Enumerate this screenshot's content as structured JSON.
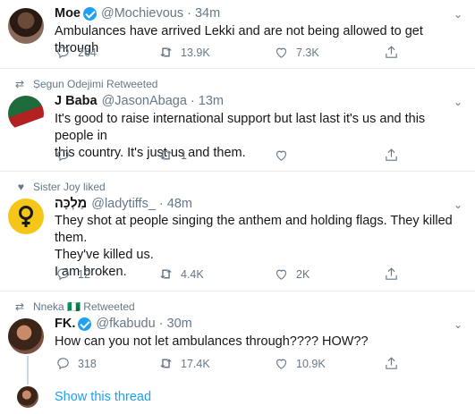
{
  "tweets": [
    {
      "name": "Moe",
      "verified": true,
      "handle": "@Mochievous",
      "time": "34m",
      "text": [
        "Ambulances have arrived Lekki and are not being allowed to get through"
      ],
      "replies": "264",
      "retweets": "13.9K",
      "likes": "7.3K"
    },
    {
      "context": "Ṣegun Odejimi Retweeted",
      "name": "J Baba",
      "handle": "@JasonAbaga",
      "time": "13m",
      "text": [
        "It's good to raise international support but last last it's us and this people in",
        "this country. It's just us and them."
      ],
      "replies": "",
      "retweets": "1",
      "likes": ""
    },
    {
      "context": "Sister Joy liked",
      "name": "מַלְכָּה",
      "handle": "@ladytiffs_",
      "time": "48m",
      "text": [
        "They shot at people singing the anthem and holding flags. They killed them.",
        "They've killed us.",
        "I am broken."
      ],
      "replies": "12",
      "retweets": "4.4K",
      "likes": "2K"
    },
    {
      "context": "Nneka 🇳🇬 Retweeted",
      "name": "FK.",
      "verified": true,
      "handle": "@fkabudu",
      "time": "30m",
      "text": [
        "How can you not let ambulances through???? HOW??"
      ],
      "replies": "318",
      "retweets": "17.4K",
      "likes": "10.9K"
    }
  ],
  "show_thread": "Show this thread",
  "colors": {
    "accent": "#1da1f2",
    "muted": "#657786",
    "border": "#e6ecf0"
  }
}
